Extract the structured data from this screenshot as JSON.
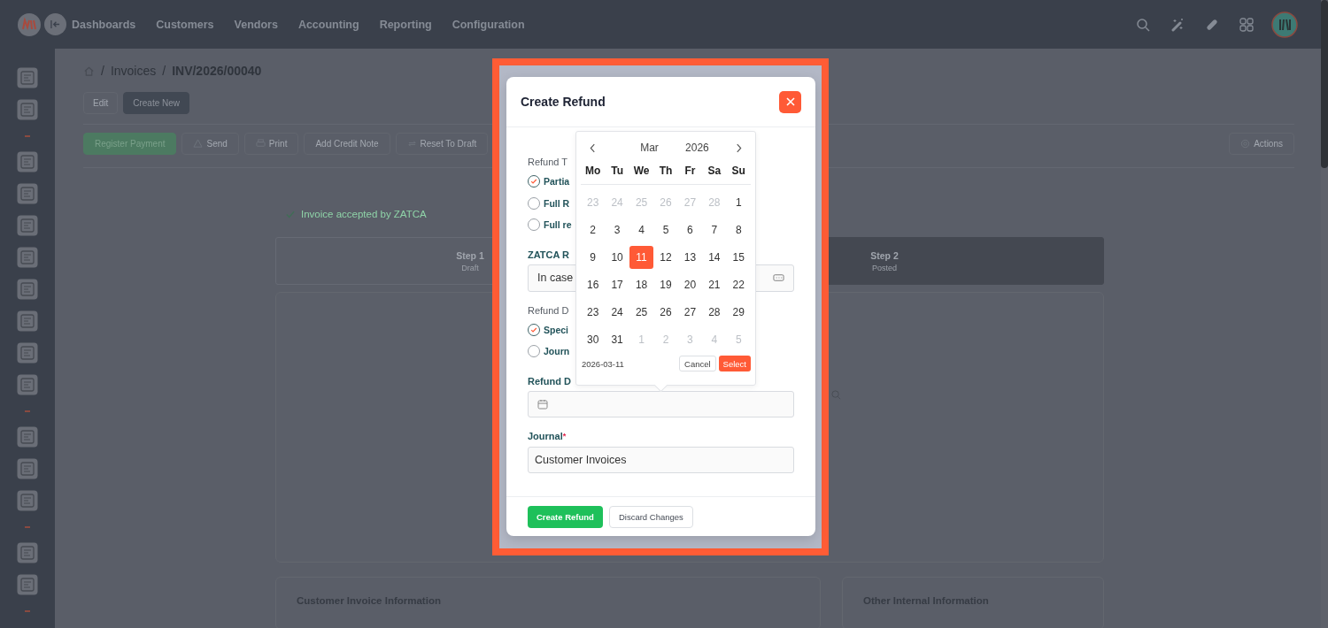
{
  "topbar": {
    "nav": [
      {
        "label": "Dashboards"
      },
      {
        "label": "Customers"
      },
      {
        "label": "Vendors"
      },
      {
        "label": "Accounting"
      },
      {
        "label": "Reporting"
      },
      {
        "label": "Configuration"
      }
    ]
  },
  "breadcrumb": [
    {
      "sep": "/",
      "label": "Invoices"
    },
    {
      "sep": "/",
      "label": "INV/2026/00040"
    }
  ],
  "record_buttons": [
    {
      "label": "Edit",
      "kind": "plain"
    },
    {
      "label": "Create New",
      "kind": "dark"
    }
  ],
  "toolbar": [
    {
      "label": "Register Payment",
      "kind": "primary"
    },
    {
      "label": "Send",
      "kind": "send"
    },
    {
      "label": "Print",
      "kind": "print"
    },
    {
      "label": "Add Credit Note",
      "kind": "plain"
    },
    {
      "label": "Reset To Draft",
      "kind": "reset"
    }
  ],
  "actions_button": {
    "label": "Actions"
  },
  "status_message": "Invoice accepted by ZATCA",
  "steps": [
    {
      "title": "Step 1",
      "subtitle": "Draft",
      "selected": false
    },
    {
      "title": "Step 2",
      "subtitle": "Posted",
      "selected": true
    }
  ],
  "sections": [
    "Customer Invoice Information",
    "Other Internal Information"
  ],
  "modal": {
    "title": "Create Refund",
    "fields": [
      {
        "kind": "radios",
        "label": "Refund T",
        "options": [
          {
            "label": "Partia",
            "selected": true
          },
          {
            "label": "Full R",
            "selected": false
          },
          {
            "label": "Full re",
            "selected": false
          }
        ]
      },
      {
        "kind": "text",
        "label": "ZATCA R",
        "value": "In case"
      },
      {
        "kind": "radios",
        "label": "Refund D",
        "options": [
          {
            "label": "Speci",
            "selected": true
          },
          {
            "label": "Journ",
            "selected": false
          }
        ]
      },
      {
        "kind": "date",
        "label": "Refund D"
      },
      {
        "kind": "select",
        "label": "Journal",
        "required_mark": "*",
        "value": "Customer Invoices"
      }
    ],
    "buttons": [
      {
        "label": "Create Refund",
        "kind": "primary"
      },
      {
        "label": "Discard Changes",
        "kind": "secondary"
      }
    ]
  },
  "calendar": {
    "month": "Mar",
    "year": "2026",
    "weekdays": [
      "Mo",
      "Tu",
      "We",
      "Th",
      "Fr",
      "Sa",
      "Su"
    ],
    "weeks": [
      [
        {
          "day": "23",
          "muted": true,
          "selected": false
        },
        {
          "day": "24",
          "muted": true,
          "selected": false
        },
        {
          "day": "25",
          "muted": true,
          "selected": false
        },
        {
          "day": "26",
          "muted": true,
          "selected": false
        },
        {
          "day": "27",
          "muted": true,
          "selected": false
        },
        {
          "day": "28",
          "muted": true,
          "selected": false
        },
        {
          "day": "1",
          "muted": false,
          "selected": false
        }
      ],
      [
        {
          "day": "2",
          "muted": false,
          "selected": false
        },
        {
          "day": "3",
          "muted": false,
          "selected": false
        },
        {
          "day": "4",
          "muted": false,
          "selected": false
        },
        {
          "day": "5",
          "muted": false,
          "selected": false
        },
        {
          "day": "6",
          "muted": false,
          "selected": false
        },
        {
          "day": "7",
          "muted": false,
          "selected": false
        },
        {
          "day": "8",
          "muted": false,
          "selected": false
        }
      ],
      [
        {
          "day": "9",
          "muted": false,
          "selected": false
        },
        {
          "day": "10",
          "muted": false,
          "selected": false
        },
        {
          "day": "11",
          "muted": false,
          "selected": true
        },
        {
          "day": "12",
          "muted": false,
          "selected": false
        },
        {
          "day": "13",
          "muted": false,
          "selected": false
        },
        {
          "day": "14",
          "muted": false,
          "selected": false
        },
        {
          "day": "15",
          "muted": false,
          "selected": false
        }
      ],
      [
        {
          "day": "16",
          "muted": false,
          "selected": false
        },
        {
          "day": "17",
          "muted": false,
          "selected": false
        },
        {
          "day": "18",
          "muted": false,
          "selected": false
        },
        {
          "day": "19",
          "muted": false,
          "selected": false
        },
        {
          "day": "20",
          "muted": false,
          "selected": false
        },
        {
          "day": "21",
          "muted": false,
          "selected": false
        },
        {
          "day": "22",
          "muted": false,
          "selected": false
        }
      ],
      [
        {
          "day": "23",
          "muted": false,
          "selected": false
        },
        {
          "day": "24",
          "muted": false,
          "selected": false
        },
        {
          "day": "25",
          "muted": false,
          "selected": false
        },
        {
          "day": "26",
          "muted": false,
          "selected": false
        },
        {
          "day": "27",
          "muted": false,
          "selected": false
        },
        {
          "day": "28",
          "muted": false,
          "selected": false
        },
        {
          "day": "29",
          "muted": false,
          "selected": false
        }
      ],
      [
        {
          "day": "30",
          "muted": false,
          "selected": false
        },
        {
          "day": "31",
          "muted": false,
          "selected": false
        },
        {
          "day": "1",
          "muted": true,
          "selected": false
        },
        {
          "day": "2",
          "muted": true,
          "selected": false
        },
        {
          "day": "3",
          "muted": true,
          "selected": false
        },
        {
          "day": "4",
          "muted": true,
          "selected": false
        },
        {
          "day": "5",
          "muted": true,
          "selected": false
        }
      ]
    ],
    "selected_date": "2026-03-11",
    "buttons": [
      {
        "label": "Cancel",
        "kind": "secondary"
      },
      {
        "label": "Select",
        "kind": "primary"
      }
    ]
  }
}
